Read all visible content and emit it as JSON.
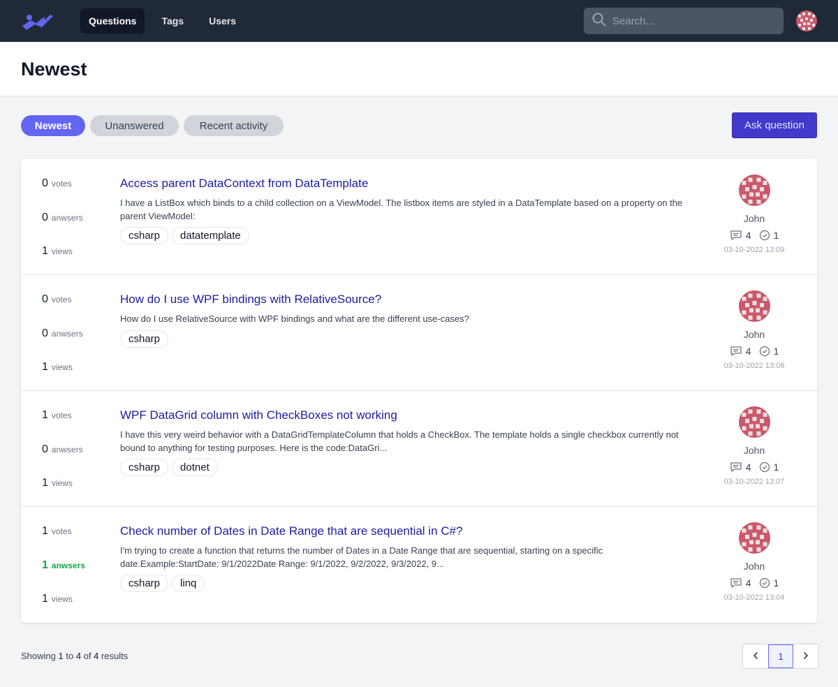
{
  "nav": {
    "logo": "app-logo",
    "items": [
      {
        "label": "Questions",
        "active": true
      },
      {
        "label": "Tags",
        "active": false
      },
      {
        "label": "Users",
        "active": false
      }
    ],
    "search_placeholder": "Search..."
  },
  "page": {
    "title": "Newest"
  },
  "filters": {
    "tabs": [
      {
        "label": "Newest",
        "active": true
      },
      {
        "label": "Unanswered",
        "active": false
      },
      {
        "label": "Recent activity",
        "active": false
      }
    ],
    "ask_label": "Ask question"
  },
  "questions": [
    {
      "votes": "0",
      "votes_label": "votes",
      "answers": "0",
      "answers_label": "anwsers",
      "answered": false,
      "views": "1",
      "views_label": "views",
      "title": "Access parent DataContext from DataTemplate",
      "excerpt": "I have a ListBox which binds to a child collection on a ViewModel. The listbox items are styled in a DataTemplate based on a property on the parent ViewModel:",
      "tags": [
        "csharp",
        "datatemplate"
      ],
      "author": "John",
      "comments": "4",
      "accepted": "1",
      "timestamp": "03-10-2022 13:09"
    },
    {
      "votes": "0",
      "votes_label": "votes",
      "answers": "0",
      "answers_label": "anwsers",
      "answered": false,
      "views": "1",
      "views_label": "views",
      "title": "How do I use WPF bindings with RelativeSource?",
      "excerpt": "How do I use RelativeSource with WPF bindings and what are the different use-cases?",
      "tags": [
        "csharp"
      ],
      "author": "John",
      "comments": "4",
      "accepted": "1",
      "timestamp": "03-10-2022 13:08"
    },
    {
      "votes": "1",
      "votes_label": "votes",
      "answers": "0",
      "answers_label": "anwsers",
      "answered": false,
      "views": "1",
      "views_label": "views",
      "title": "WPF DataGrid column with CheckBoxes not working",
      "excerpt": "I have this very weird behavior with a DataGridTemplateColumn that holds a CheckBox. The template holds a single checkbox currently not bound to anything for testing purposes. Here is the code:DataGri...",
      "tags": [
        "csharp",
        "dotnet"
      ],
      "author": "John",
      "comments": "4",
      "accepted": "1",
      "timestamp": "03-10-2022 13:07"
    },
    {
      "votes": "1",
      "votes_label": "votes",
      "answers": "1",
      "answers_label": "anwsers",
      "answered": true,
      "views": "1",
      "views_label": "views",
      "title": "Check number of Dates in Date Range that are sequential in C#?",
      "excerpt": "I'm trying to create a function that returns the number of Dates in a Date Range that are sequential, starting on a specific date.Example:StartDate: 9/1/2022Date Range: 9/1/2022, 9/2/2022, 9/3/2022, 9...",
      "tags": [
        "csharp",
        "linq"
      ],
      "author": "John",
      "comments": "4",
      "accepted": "1",
      "timestamp": "03-10-2022 13:04"
    }
  ],
  "footer": {
    "showing": "Showing",
    "from": "1",
    "to_word": "to",
    "to": "4",
    "of_word": "of",
    "total": "4",
    "results_word": "results",
    "current_page": "1"
  },
  "colors": {
    "accent": "#6366f1",
    "button": "#4338ca",
    "topbar": "#1f2937",
    "answered": "#16a34a",
    "title_link": "#1e1b9e"
  }
}
